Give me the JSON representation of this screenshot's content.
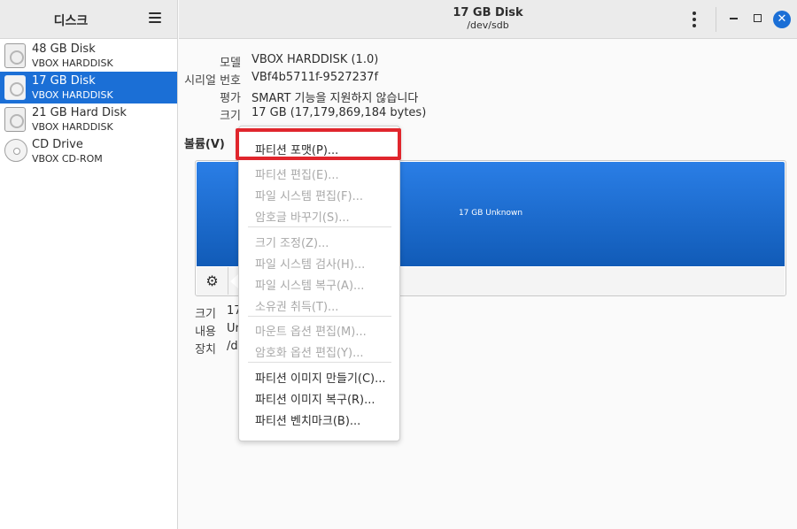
{
  "sidebar": {
    "title": "디스크",
    "disks": [
      {
        "name": "48 GB Disk",
        "model": "VBOX HARDDISK",
        "type": "disk"
      },
      {
        "name": "17 GB Disk",
        "model": "VBOX HARDDISK",
        "type": "disk",
        "selected": true
      },
      {
        "name": "21 GB Hard Disk",
        "model": "VBOX HARDDISK",
        "type": "disk"
      },
      {
        "name": "CD Drive",
        "model": "VBOX CD-ROM",
        "type": "cdrom"
      }
    ]
  },
  "header": {
    "title": "17 GB Disk",
    "subtitle": "/dev/sdb",
    "close_glyph": "✕"
  },
  "drive_info": {
    "model_label": "모델",
    "model_value": "VBOX HARDDISK (1.0)",
    "serial_label": "시리얼 번호",
    "serial_value": "VBf4b5711f-9527237f",
    "assessment_label": "평가",
    "assessment_value": "SMART 기능을 지원하지 않습니다",
    "size_label": "크기",
    "size_value": "17 GB (17,179,869,184 bytes)"
  },
  "volumes": {
    "heading": "볼륨(V)",
    "partition_label": "17 GB Unknown",
    "gear_icon": "gear-icon"
  },
  "partition_info": {
    "size_label": "크기",
    "size_value_partial": "17",
    "contents_label": "내용",
    "contents_value_partial": "Ur",
    "device_label": "장치",
    "device_value_partial": "/d"
  },
  "context_menu": {
    "items": [
      {
        "label": "파티션 포맷(P)...",
        "enabled": true,
        "highlighted": true
      },
      {
        "label": "파티션 편집(E)...",
        "enabled": false
      },
      {
        "label": "파일 시스템 편집(F)...",
        "enabled": false
      },
      {
        "label": "암호글 바꾸기(S)...",
        "enabled": false
      },
      {
        "label": "크기 조정(Z)...",
        "enabled": false
      },
      {
        "label": "파일 시스템 검사(H)...",
        "enabled": false
      },
      {
        "label": "파일 시스템 복구(A)...",
        "enabled": false
      },
      {
        "label": "소유권 취득(T)...",
        "enabled": false
      },
      {
        "label": "마운트 옵션 편집(M)...",
        "enabled": false
      },
      {
        "label": "암호화 옵션 편집(Y)...",
        "enabled": false
      },
      {
        "label": "파티션 이미지 만들기(C)...",
        "enabled": true
      },
      {
        "label": "파티션 이미지 복구(R)...",
        "enabled": true
      },
      {
        "label": "파티션 벤치마크(B)...",
        "enabled": true
      }
    ]
  },
  "colors": {
    "accent": "#1b6fd6",
    "highlight_border": "#e0262d"
  }
}
